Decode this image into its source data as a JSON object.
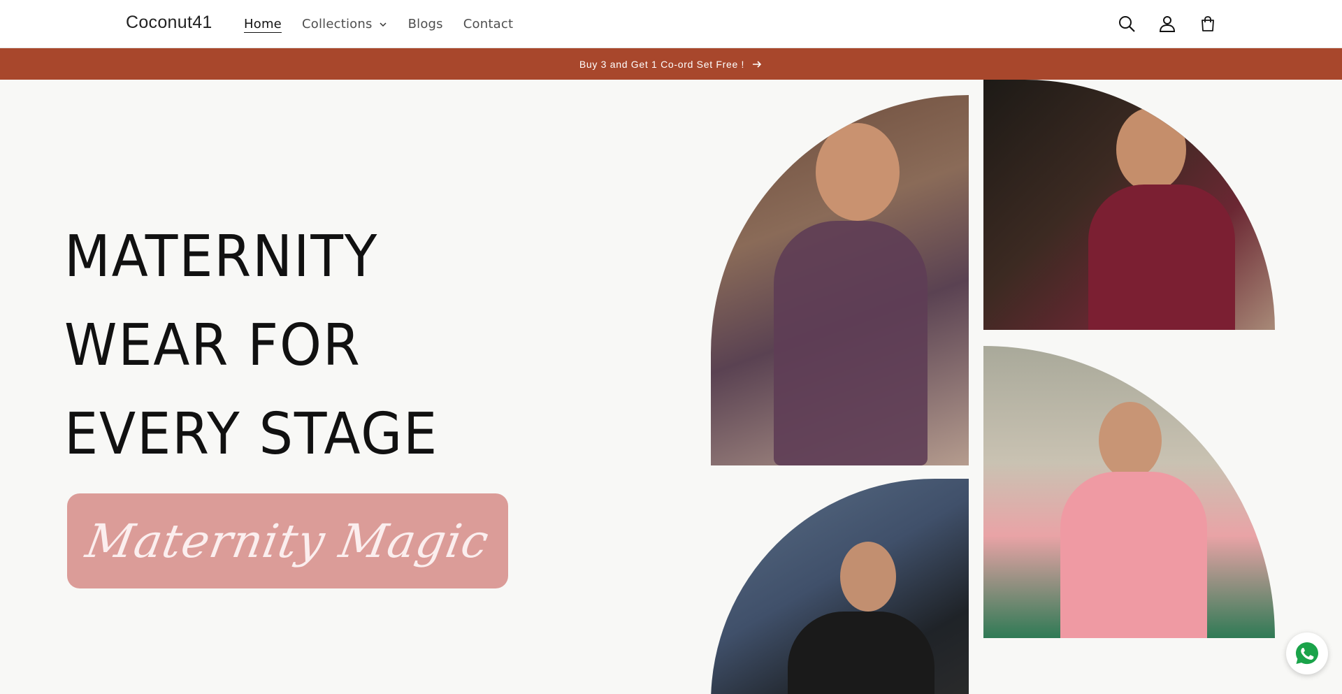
{
  "brand": {
    "name": "Coconut41"
  },
  "nav": {
    "items": [
      {
        "label": "Home",
        "active": true
      },
      {
        "label": "Collections",
        "has_dropdown": true
      },
      {
        "label": "Blogs"
      },
      {
        "label": "Contact"
      }
    ]
  },
  "header_icons": [
    "search-icon",
    "account-icon",
    "cart-icon"
  ],
  "announcement": {
    "text": "Buy 3 and Get 1 Co-ord Set Free !",
    "icon": "arrow-right-icon"
  },
  "hero": {
    "title_lines": [
      "MATERNITY",
      "WEAR FOR",
      "EVERY STAGE"
    ],
    "tagline": "Maternity Magic",
    "images": [
      "woman-purple-dress",
      "woman-maroon-floral-dress",
      "woman-pink-dress",
      "woman-black-dress"
    ]
  },
  "floating": {
    "icon": "whatsapp-icon"
  },
  "colors": {
    "announcement_bg": "#a8472c",
    "tagline_bg": "#db9c98",
    "hero_bg": "#f8f8f6",
    "whatsapp": "#1aa34a"
  }
}
